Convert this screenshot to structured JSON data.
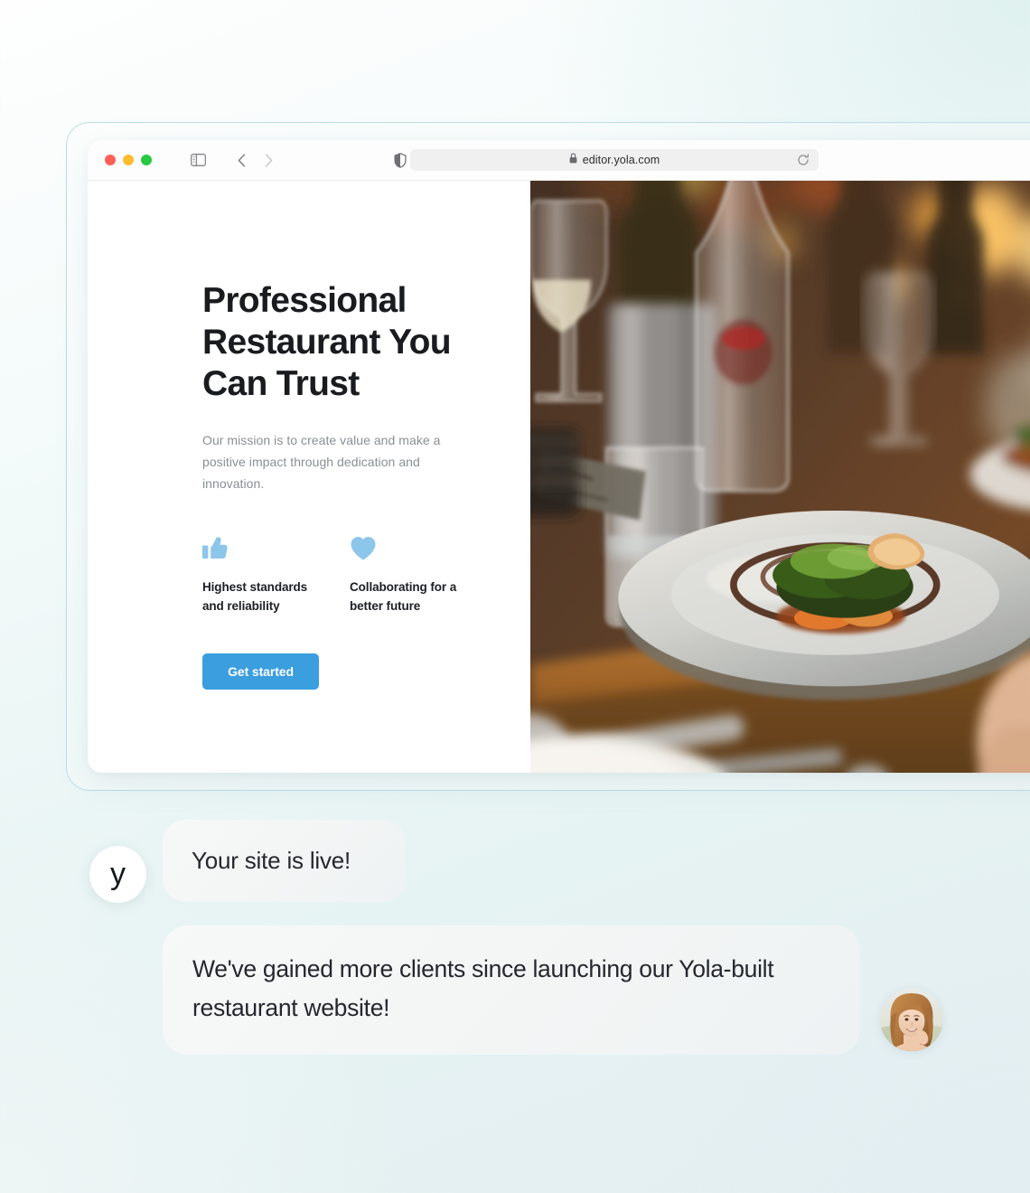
{
  "browser": {
    "window_controls": [
      "close",
      "minimize",
      "maximize"
    ],
    "sidebar_toggle_icon": "sidebar-toggle-icon",
    "back_icon": "chevron-left-icon",
    "forward_icon": "chevron-right-icon",
    "shield_icon": "shield-icon",
    "lock_icon": "lock-icon",
    "url": "editor.yola.com",
    "reload_icon": "reload-icon"
  },
  "site": {
    "hero_title": "Professional Restaurant You Can Trust",
    "hero_subtitle": "Our mission is to create value and make a positive impact through dedication and innovation.",
    "features": [
      {
        "icon": "thumbs-up-icon",
        "label": "Highest standards and reliability"
      },
      {
        "icon": "heart-icon",
        "label": "Collaborating for a better future"
      }
    ],
    "cta_label": "Get started",
    "hero_image_alt": "Plated gourmet dish on a restaurant table with wine glasses"
  },
  "chat": {
    "brand_mark": "y",
    "messages": [
      {
        "author": "yola",
        "text": "Your site is live!"
      },
      {
        "author": "client",
        "text": "We've gained more clients since launching our Yola-built restaurant website!"
      }
    ],
    "client_avatar_alt": "Smiling woman portrait"
  },
  "colors": {
    "accent_blue": "#3b9ede",
    "icon_blue": "#8cc6ea",
    "heading": "#191b1f",
    "body_text": "#8a8f96",
    "bubble_bg": "#f3f5f5",
    "frame_border": "#bcdcec"
  }
}
